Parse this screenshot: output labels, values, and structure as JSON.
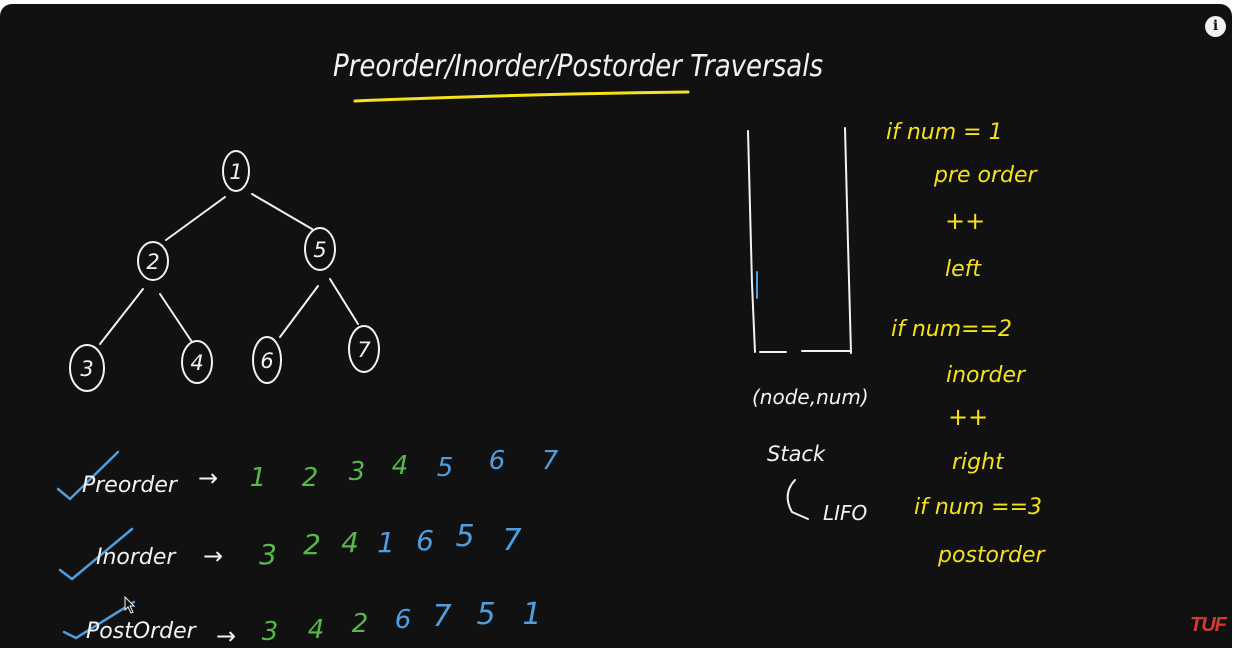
{
  "title": "Preorder/Inorder/Postorder Traversals",
  "tree": {
    "nodes": [
      "1",
      "2",
      "5",
      "3",
      "4",
      "6",
      "7"
    ]
  },
  "traversals": [
    {
      "name": "Preorder",
      "arrow": "→",
      "values": [
        "1",
        "2",
        "3",
        "4",
        "5",
        "6",
        "7"
      ]
    },
    {
      "name": "Inorder",
      "arrow": "→",
      "values": [
        "3",
        "2",
        "4",
        "1",
        "6",
        "5",
        "7"
      ]
    },
    {
      "name": "PostOrder",
      "arrow": "→",
      "values": [
        "3",
        "4",
        "2",
        "6",
        "7",
        "5",
        "1"
      ]
    }
  ],
  "stack": {
    "item": "(node,num)",
    "label": "Stack",
    "note": "LIFO"
  },
  "rules": [
    "if num = 1",
    "pre order",
    "++",
    "left",
    "if num==2",
    "inorder",
    "++",
    "right",
    "if num ==3",
    "postorder"
  ],
  "overlay": {
    "info_icon": "i",
    "logo": "TUF"
  },
  "colors": {
    "board": "#111111",
    "chalk": "#f2f2f2",
    "highlight": "#f5e21b",
    "green": "#57b94a",
    "blue": "#4f9fe0",
    "logo": "#d83a2e"
  }
}
